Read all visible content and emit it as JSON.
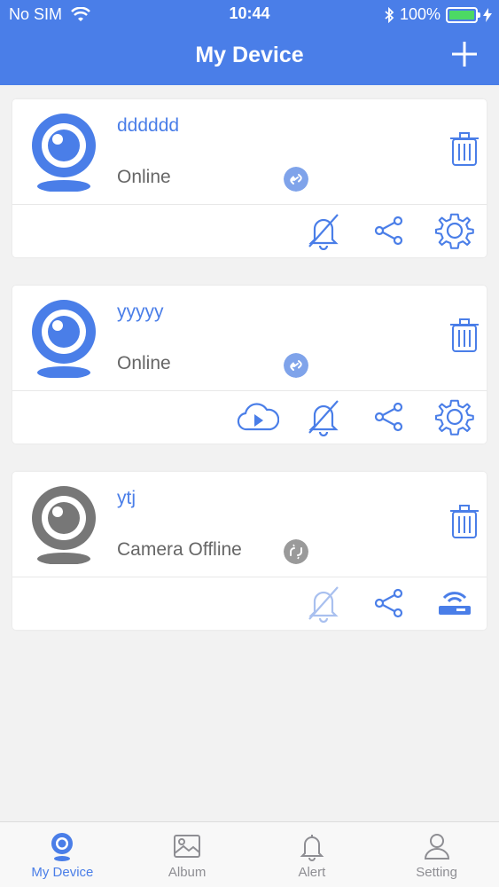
{
  "status_bar": {
    "carrier": "No SIM",
    "time": "10:44",
    "battery": "100%"
  },
  "header": {
    "title": "My Device",
    "add_icon": "plus-icon"
  },
  "devices": [
    {
      "name": "dddddd",
      "status": "Online",
      "online": true,
      "actions": [
        "alarm-off-icon",
        "share-icon",
        "settings-icon"
      ]
    },
    {
      "name": "yyyyy",
      "status": "Online",
      "online": true,
      "actions": [
        "cloud-play-icon",
        "alarm-off-icon",
        "share-icon",
        "settings-icon"
      ]
    },
    {
      "name": "ytj",
      "status": "Camera Offline",
      "online": false,
      "actions": [
        "alarm-off-icon",
        "share-icon",
        "router-icon"
      ]
    }
  ],
  "tabs": [
    {
      "label": "My Device",
      "icon": "camera-icon",
      "active": true
    },
    {
      "label": "Album",
      "icon": "image-icon",
      "active": false
    },
    {
      "label": "Alert",
      "icon": "bell-icon",
      "active": false
    },
    {
      "label": "Setting",
      "icon": "person-icon",
      "active": false
    }
  ],
  "colors": {
    "accent": "#4a7ee8",
    "offline_gray": "#777777",
    "battery_green": "#4cd964"
  }
}
